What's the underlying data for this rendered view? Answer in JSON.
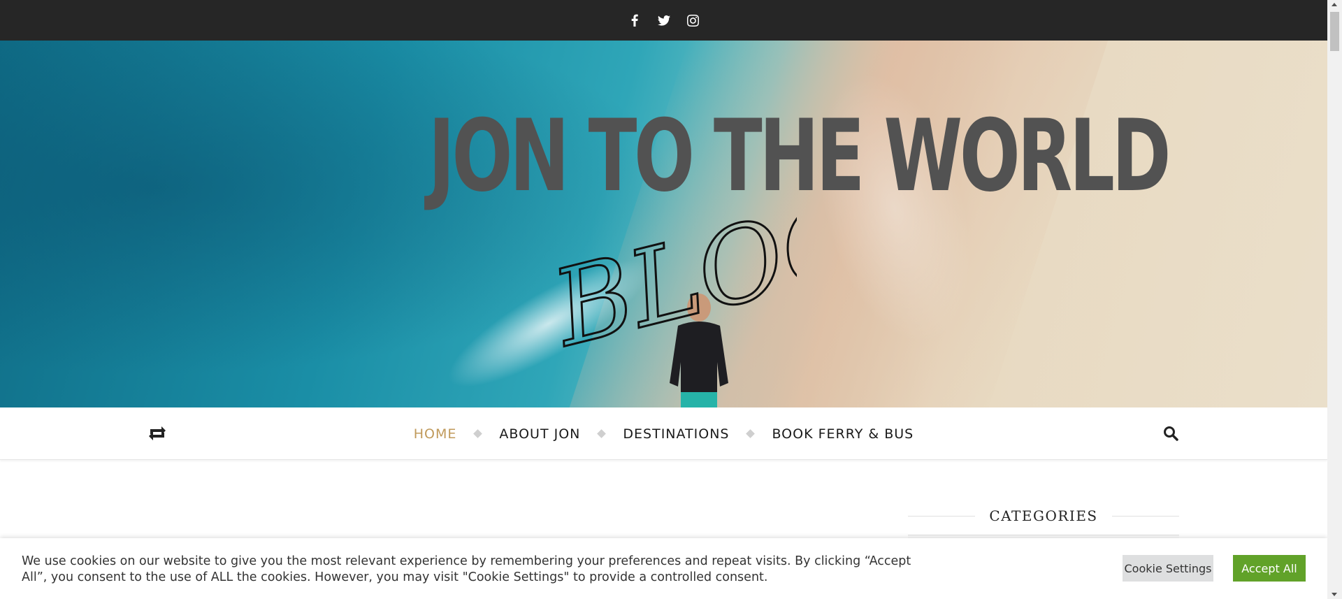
{
  "social": {
    "icons": [
      "facebook-icon",
      "twitter-icon",
      "instagram-icon"
    ]
  },
  "header": {
    "logo_title": "JON TO THE WORLD",
    "logo_script": "BLOG"
  },
  "nav": {
    "items": [
      {
        "label": "HOME",
        "active": true
      },
      {
        "label": "ABOUT JON",
        "active": false
      },
      {
        "label": "DESTINATIONS",
        "active": false
      },
      {
        "label": "BOOK FERRY & BUS",
        "active": false
      }
    ],
    "accent_color": "#c09a5b",
    "left_icon": "shuffle-icon",
    "right_icon": "search-icon"
  },
  "sidebar": {
    "widget_title": "CATEGORIES"
  },
  "cookie": {
    "text": "We use cookies on our website to give you the most relevant experience by remembering your preferences and repeat visits. By clicking “Accept All”, you consent to the use of ALL the cookies. However, you may visit \"Cookie Settings\" to provide a controlled consent.",
    "settings_label": "Cookie Settings",
    "accept_label": "Accept All",
    "accept_color": "#61a229"
  }
}
